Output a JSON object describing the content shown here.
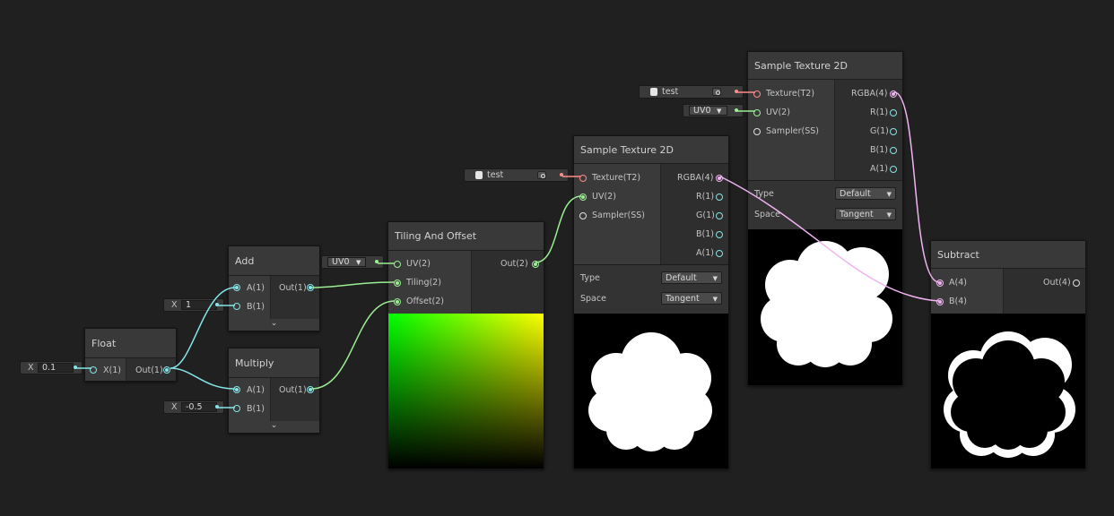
{
  "colors": {
    "float_wire": "#84e4e7",
    "uv_wire": "#9aef92",
    "texture_wire": "#ff8b8b",
    "vector4_wire": "#f1b3f1",
    "background": "#202020"
  },
  "inputs": {
    "float_x": {
      "label": "X",
      "value": "0.1"
    },
    "add_b": {
      "label": "X",
      "value": "1"
    },
    "multiply_b": {
      "label": "X",
      "value": "-0.5"
    },
    "uv_channel_1": {
      "value": "UV0"
    },
    "uv_channel_2": {
      "value": "UV0"
    },
    "texture_1": {
      "value": "test"
    },
    "texture_2": {
      "value": "test"
    }
  },
  "nodes": {
    "float": {
      "title": "Float",
      "in": [
        "X(1)"
      ],
      "out": [
        "Out(1)"
      ]
    },
    "add": {
      "title": "Add",
      "in": [
        "A(1)",
        "B(1)"
      ],
      "out": [
        "Out(1)"
      ]
    },
    "multiply": {
      "title": "Multiply",
      "in": [
        "A(1)",
        "B(1)"
      ],
      "out": [
        "Out(1)"
      ]
    },
    "tiling": {
      "title": "Tiling And Offset",
      "in": [
        "UV(2)",
        "Tiling(2)",
        "Offset(2)"
      ],
      "out": [
        "Out(2)"
      ]
    },
    "sample1": {
      "title": "Sample Texture 2D",
      "in": [
        "Texture(T2)",
        "UV(2)",
        "Sampler(SS)"
      ],
      "out": [
        "RGBA(4)",
        "R(1)",
        "G(1)",
        "B(1)",
        "A(1)"
      ],
      "type_label": "Type",
      "type_value": "Default",
      "space_label": "Space",
      "space_value": "Tangent"
    },
    "sample2": {
      "title": "Sample Texture 2D",
      "in": [
        "Texture(T2)",
        "UV(2)",
        "Sampler(SS)"
      ],
      "out": [
        "RGBA(4)",
        "R(1)",
        "G(1)",
        "B(1)",
        "A(1)"
      ],
      "type_label": "Type",
      "type_value": "Default",
      "space_label": "Space",
      "space_value": "Tangent"
    },
    "subtract": {
      "title": "Subtract",
      "in": [
        "A(4)",
        "B(4)"
      ],
      "out": [
        "Out(4)"
      ]
    }
  },
  "icons": {
    "collapse": "chevron-down-icon",
    "dropdown": "triangle-down-icon",
    "texture": "texture-icon",
    "object_picker": "target-icon"
  }
}
